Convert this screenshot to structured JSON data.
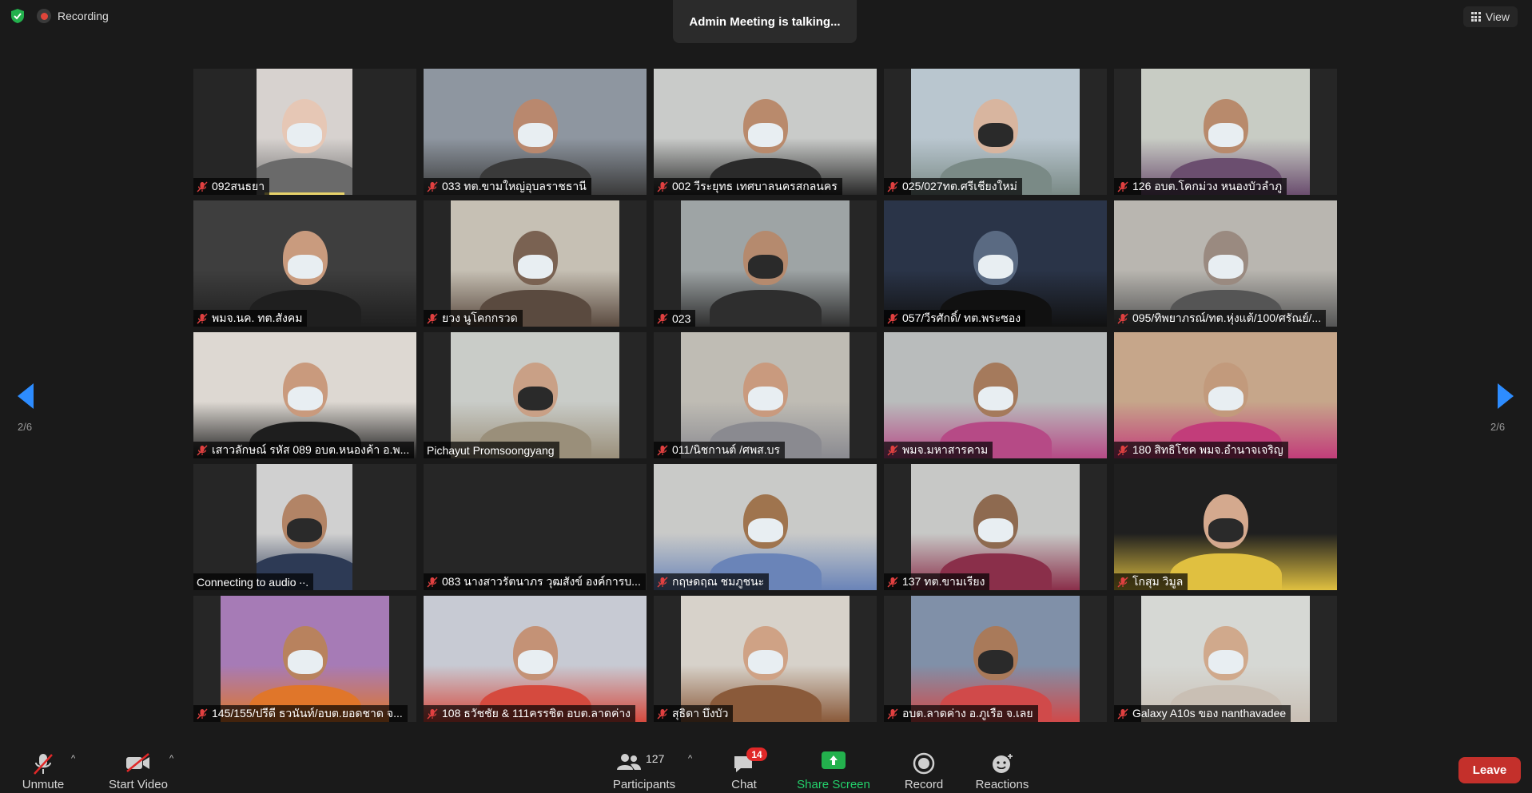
{
  "top": {
    "recording_label": "Recording",
    "talking_banner": "Admin Meeting is talking...",
    "view_label": "View"
  },
  "paging": {
    "left": "2/6",
    "right": "2/6"
  },
  "participants_tiles": [
    {
      "name": "092สนธยา",
      "muted": true
    },
    {
      "name": "033 ทต.ขามใหญ่อุบลราชธานี",
      "muted": true
    },
    {
      "name": "002 วีระยุทธ เทศบาลนครสกลนคร",
      "muted": true
    },
    {
      "name": "025/027ทต.ศรีเชียงใหม่",
      "muted": true
    },
    {
      "name": "126 อบต.โคกม่วง หนองบัวลำภู",
      "muted": true
    },
    {
      "name": "พมจ.นค. ทต.สังคม",
      "muted": true
    },
    {
      "name": "ยวง นูโคกกรวด",
      "muted": true
    },
    {
      "name": "023",
      "muted": true
    },
    {
      "name": "057/วีรศักดิ์/ ทต.พระซอง",
      "muted": true
    },
    {
      "name": "095/ทิพยาภรณ์/ทต.หุ่งแต้/100/ศรัณย์/...",
      "muted": true
    },
    {
      "name": "เสาวลักษณ์ รหัส 089 อบต.หนองค้า อ.พ...",
      "muted": true
    },
    {
      "name": "Pichayut Promsoongyang",
      "muted": false
    },
    {
      "name": "011/นิชกานต์ /ศพส.บร",
      "muted": true
    },
    {
      "name": "พมจ.มหาสารคาม",
      "muted": true
    },
    {
      "name": "180 สิทธิโชค พมจ.อำนาจเจริญ",
      "muted": true
    },
    {
      "name": "Connecting to audio ∙∙.",
      "muted": false
    },
    {
      "name": "083 นางสาวรัตนาภร วุฒสังข์ องค์การบ...",
      "muted": true
    },
    {
      "name": "กฤษดฤณ ชมภูชนะ",
      "muted": true
    },
    {
      "name": "137 ทต.ขามเรียง",
      "muted": true
    },
    {
      "name": "โกสุม วิมูล",
      "muted": true
    },
    {
      "name": "145/155/ปรีดี ธวนันท์/อบต.ยอดชาด จ...",
      "muted": true
    },
    {
      "name": "108 ธวัชชัย & 111ครรชิต อบต.ลาดค่าง",
      "muted": true
    },
    {
      "name": "สุธิดา บึงบัว",
      "muted": true
    },
    {
      "name": "อบต.ลาดค่าง อ.ภูเรือ จ.เลย",
      "muted": true
    },
    {
      "name": "Galaxy A10s ของ nanthavadee",
      "muted": true
    }
  ],
  "toolbar": {
    "unmute": "Unmute",
    "start_video": "Start Video",
    "participants": "Participants",
    "participant_count": "127",
    "chat": "Chat",
    "chat_badge": "14",
    "share_screen": "Share Screen",
    "record": "Record",
    "reactions": "Reactions",
    "leave": "Leave"
  }
}
